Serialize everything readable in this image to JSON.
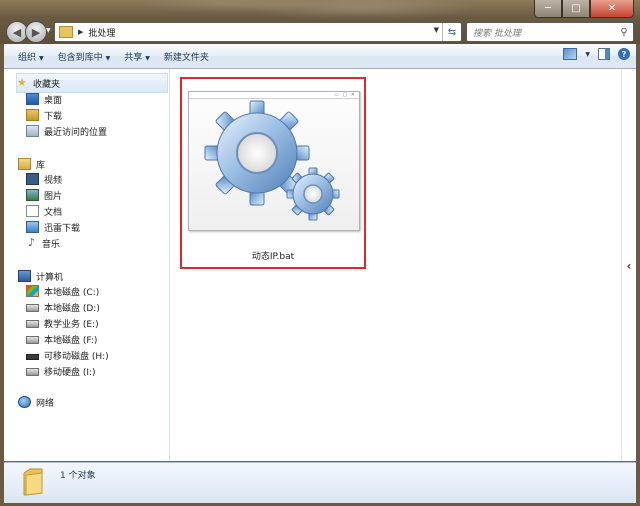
{
  "window": {
    "address_path": "批处理",
    "search_placeholder": "搜索 批处理",
    "caption": {
      "minimize": "─",
      "maximize": "□",
      "close": "✕"
    }
  },
  "toolbar": {
    "organize": "组织",
    "include_in_library": "包含到库中",
    "share": "共享",
    "new_folder": "新建文件夹"
  },
  "sidebar": {
    "favorites": {
      "label": "收藏夹",
      "items": [
        "桌面",
        "下载",
        "最近访问的位置"
      ]
    },
    "libraries": {
      "label": "库",
      "items": [
        "视频",
        "图片",
        "文档",
        "迅雷下载",
        "音乐"
      ]
    },
    "computer": {
      "label": "计算机",
      "items": [
        "本地磁盘 (C:)",
        "本地磁盘 (D:)",
        "教学业务 (E:)",
        "本地磁盘 (F:)",
        "可移动磁盘 (H:)",
        "移动硬盘 (I:)"
      ]
    },
    "network": {
      "label": "网络"
    }
  },
  "content": {
    "files": [
      {
        "name": "动态IP.bat",
        "icon": "gear-batch-icon",
        "selected": true
      }
    ]
  },
  "details": {
    "count": "1 个对象"
  },
  "colors": {
    "selection_outline": "#e02a2a",
    "toolbar_text": "#1e395b",
    "frame": "#6a5a41"
  }
}
